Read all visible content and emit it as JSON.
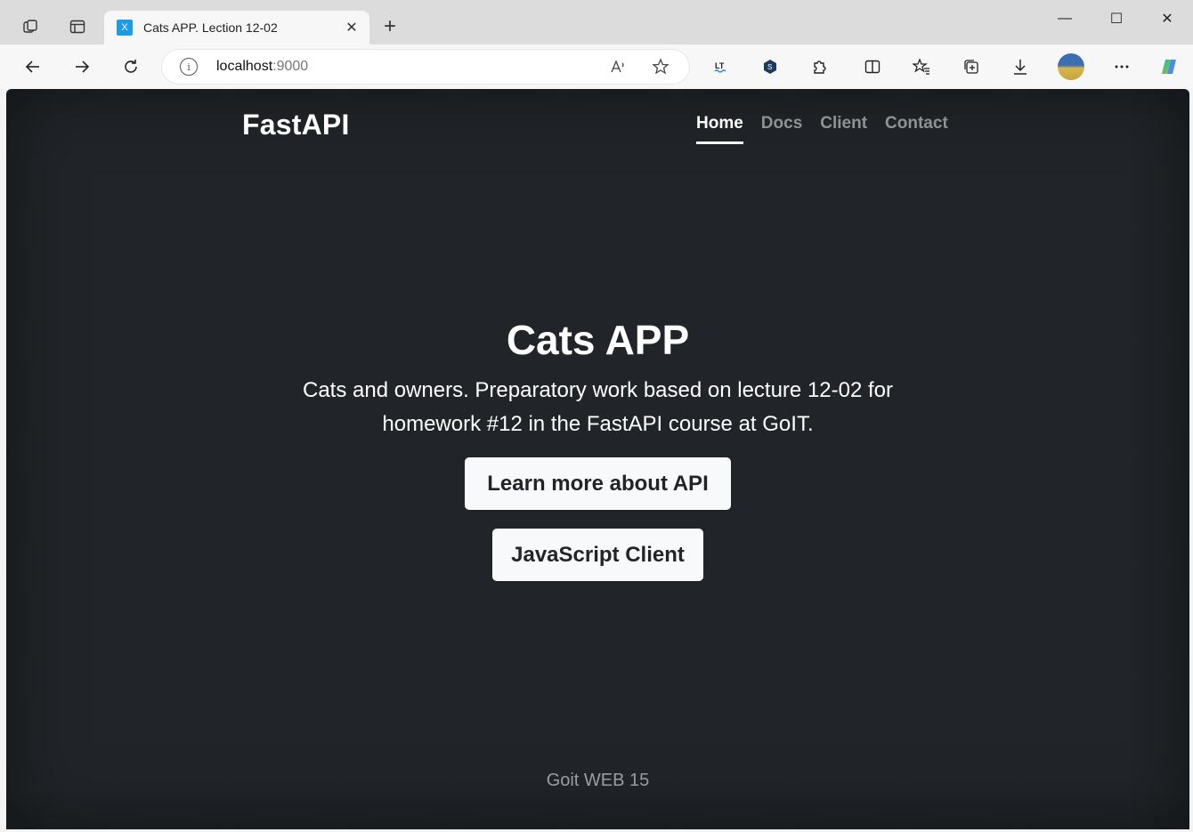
{
  "browser": {
    "tab": {
      "favicon": "X",
      "title": "Cats APP. Lection 12-02",
      "close": "✕"
    },
    "new_tab": "+",
    "window_controls": {
      "minimize": "—",
      "maximize": "☐",
      "close": "✕"
    },
    "address": {
      "host": "localhost",
      "port": ":9000",
      "info": "i"
    },
    "icons": [
      "workspaces-icon",
      "tab-actions-icon",
      "back-icon",
      "forward-icon",
      "refresh-icon",
      "read-aloud-icon",
      "favorite-star-icon",
      "languagetool-icon",
      "extension-shield-icon",
      "extensions-icon",
      "split-screen-icon",
      "favorites-icon",
      "collections-icon",
      "downloads-icon",
      "profile-avatar",
      "more-menu-icon",
      "copilot-icon"
    ]
  },
  "page": {
    "brand": "FastAPI",
    "nav": [
      {
        "label": "Home",
        "active": true
      },
      {
        "label": "Docs",
        "active": false
      },
      {
        "label": "Client",
        "active": false
      },
      {
        "label": "Contact",
        "active": false
      }
    ],
    "hero": {
      "title": "Cats APP",
      "lead_line1": "Cats and owners. Preparatory work based on lecture 12-02 for",
      "lead_line2": "homework #12 in the FastAPI course at GoIT.",
      "btn_api": "Learn more about API",
      "btn_client": "JavaScript Client"
    },
    "footer": "Goit WEB 15"
  },
  "colors": {
    "page_bg": "#212529",
    "tab_favicon": "#1e9be8",
    "button_bg": "#f8f9fa"
  }
}
